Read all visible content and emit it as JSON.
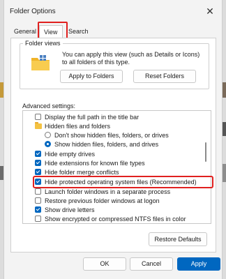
{
  "window": {
    "title": "Folder Options",
    "close_glyph": "✕"
  },
  "tabs": [
    {
      "label": "General",
      "selected": false
    },
    {
      "label": "View",
      "selected": true
    },
    {
      "label": "Search",
      "selected": false
    }
  ],
  "folder_views": {
    "label": "Folder views",
    "description": "You can apply this view (such as Details or Icons) to all folders of this type.",
    "apply_button": "Apply to Folders",
    "reset_button": "Reset Folders"
  },
  "advanced": {
    "label": "Advanced settings:",
    "items": [
      {
        "type": "checkbox",
        "checked": false,
        "label": "Display the full path in the title bar",
        "indent": 0
      },
      {
        "type": "folder",
        "label": "Hidden files and folders",
        "indent": 0
      },
      {
        "type": "radio",
        "checked": false,
        "label": "Don't show hidden files, folders, or drives",
        "indent": 1
      },
      {
        "type": "radio",
        "checked": true,
        "label": "Show hidden files, folders, and drives",
        "indent": 1
      },
      {
        "type": "checkbox",
        "checked": true,
        "label": "Hide empty drives",
        "indent": 0
      },
      {
        "type": "checkbox",
        "checked": true,
        "label": "Hide extensions for known file types",
        "indent": 0
      },
      {
        "type": "checkbox",
        "checked": true,
        "label": "Hide folder merge conflicts",
        "indent": 0
      },
      {
        "type": "checkbox",
        "checked": true,
        "label": "Hide protected operating system files (Recommended)",
        "indent": 0,
        "highlighted": true
      },
      {
        "type": "checkbox",
        "checked": false,
        "label": "Launch folder windows in a separate process",
        "indent": 0
      },
      {
        "type": "checkbox",
        "checked": false,
        "label": "Restore previous folder windows at logon",
        "indent": 0
      },
      {
        "type": "checkbox",
        "checked": true,
        "label": "Show drive letters",
        "indent": 0
      },
      {
        "type": "checkbox",
        "checked": false,
        "label": "Show encrypted or compressed NTFS files in color",
        "indent": 0
      }
    ]
  },
  "restore_defaults": "Restore Defaults",
  "footer": {
    "ok": "OK",
    "cancel": "Cancel",
    "apply": "Apply"
  },
  "colors": {
    "accent": "#0067c0",
    "highlight": "#e0201f"
  }
}
